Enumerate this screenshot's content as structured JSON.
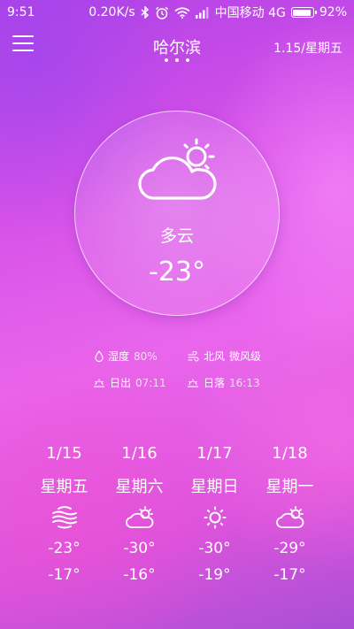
{
  "status_bar": {
    "time": "9:51",
    "speed": "0.20K/s",
    "carrier": "中国移动 4G",
    "battery_pct": "92%",
    "battery_level": 0.92,
    "icons": [
      "bluetooth-icon",
      "alarm-icon",
      "wifi-icon",
      "signal-icon",
      "battery-icon"
    ]
  },
  "header": {
    "city": "哈尔滨",
    "date": "1.15/星期五",
    "page_count": 3,
    "menu_icon": "hamburger-menu-icon"
  },
  "current": {
    "condition": "多云",
    "temperature": "-23°",
    "icon": "partly-cloudy-icon"
  },
  "details": {
    "humidity_label": "湿度",
    "humidity_value": "80%",
    "wind_label": "北风",
    "wind_value": "微风级",
    "sunrise_label": "日出",
    "sunrise_value": "07:11",
    "sunset_label": "日落",
    "sunset_value": "16:13"
  },
  "forecast": [
    {
      "date": "1/15",
      "weekday": "星期五",
      "icon": "haze-icon",
      "high": "-23°",
      "low": "-17°"
    },
    {
      "date": "1/16",
      "weekday": "星期六",
      "icon": "partly-cloudy-icon",
      "high": "-30°",
      "low": "-16°"
    },
    {
      "date": "1/17",
      "weekday": "星期日",
      "icon": "sunny-icon",
      "high": "-30°",
      "low": "-19°"
    },
    {
      "date": "1/18",
      "weekday": "星期一",
      "icon": "partly-cloudy-icon",
      "high": "-29°",
      "low": "-17°"
    }
  ],
  "colors": {
    "gradient_top": "#b142e6",
    "gradient_mid": "#e966ec",
    "gradient_bottom": "#a94fd6",
    "text": "#ffffff"
  }
}
